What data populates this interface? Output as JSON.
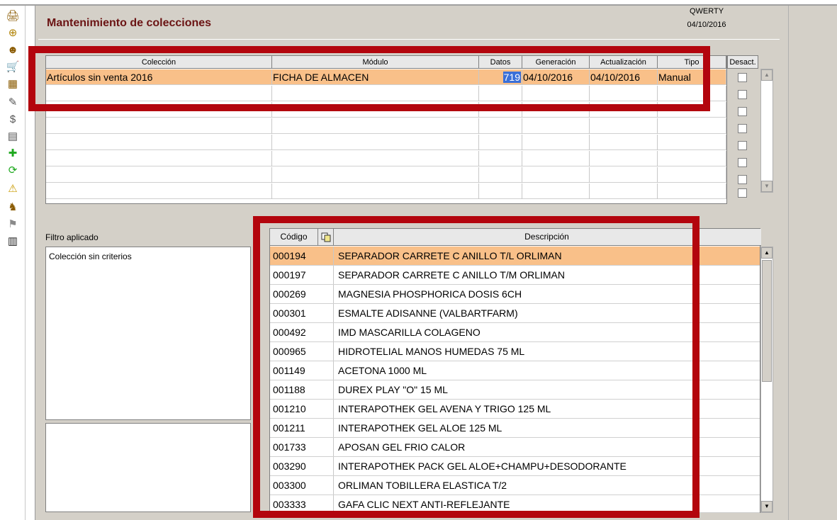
{
  "toolbar": {
    "icons": [
      "printer-icon",
      "dispatch-icon",
      "customer-icon",
      "cart-icon",
      "stock-icon",
      "edit-icon",
      "coins-icon",
      "ledger-icon",
      "add-icon",
      "refresh-icon",
      "warning-icon",
      "user-icon",
      "group-icon",
      "barcode-icon"
    ],
    "glyphs": [
      "🖨",
      "⊕",
      "☻",
      "🛒",
      "▦",
      "✎",
      "$",
      "▤",
      "✚",
      "⟳",
      "⚠",
      "♞",
      "⚑",
      "▥"
    ]
  },
  "header": {
    "title": "Mantenimiento de colecciones",
    "user": "QWERTY",
    "date": "04/10/2016"
  },
  "collections": {
    "columns": [
      "Colección",
      "Módulo",
      "Datos",
      "Generación",
      "Actualización",
      "Tipo"
    ],
    "desact_label": "Desact.",
    "rows": [
      {
        "coleccion": "Artículos sin venta 2016",
        "modulo": "FICHA DE ALMACEN",
        "datos": "719",
        "generacion": "04/10/2016",
        "actualizacion": "04/10/2016",
        "tipo": "Manual"
      }
    ]
  },
  "filter": {
    "label": "Filtro aplicado",
    "text": "Colección sin criterios"
  },
  "items": {
    "columns": [
      "Código",
      "Descripción"
    ],
    "rows": [
      {
        "codigo": "000194",
        "descripcion": "SEPARADOR CARRETE C ANILLO T/L ORLIMAN"
      },
      {
        "codigo": "000197",
        "descripcion": "SEPARADOR CARRETE C ANILLO T/M ORLIMAN"
      },
      {
        "codigo": "000269",
        "descripcion": "MAGNESIA PHOSPHORICA DOSIS 6CH"
      },
      {
        "codigo": "000301",
        "descripcion": "ESMALTE ADISANNE (VALBARTFARM)"
      },
      {
        "codigo": "000492",
        "descripcion": "IMD MASCARILLA COLAGENO"
      },
      {
        "codigo": "000965",
        "descripcion": "HIDROTELIAL MANOS HUMEDAS 75 ML"
      },
      {
        "codigo": "001149",
        "descripcion": "ACETONA 1000 ML"
      },
      {
        "codigo": "001188",
        "descripcion": "DUREX PLAY \"O\" 15 ML"
      },
      {
        "codigo": "001210",
        "descripcion": "INTERAPOTHEK GEL AVENA Y TRIGO 125 ML"
      },
      {
        "codigo": "001211",
        "descripcion": "INTERAPOTHEK GEL ALOE 125 ML"
      },
      {
        "codigo": "001733",
        "descripcion": "APOSAN GEL FRIO CALOR"
      },
      {
        "codigo": "003290",
        "descripcion": "INTERAPOTHEK PACK GEL ALOE+CHAMPU+DESODORANTE"
      },
      {
        "codigo": "003300",
        "descripcion": "ORLIMAN TOBILLERA ELASTICA T/2"
      },
      {
        "codigo": "003333",
        "descripcion": "GAFA CLIC NEXT ANTI-REFLEJANTE"
      }
    ]
  },
  "colors": {
    "selection": "#f9c089",
    "title": "#6b1414",
    "highlight": "#b3050d"
  }
}
